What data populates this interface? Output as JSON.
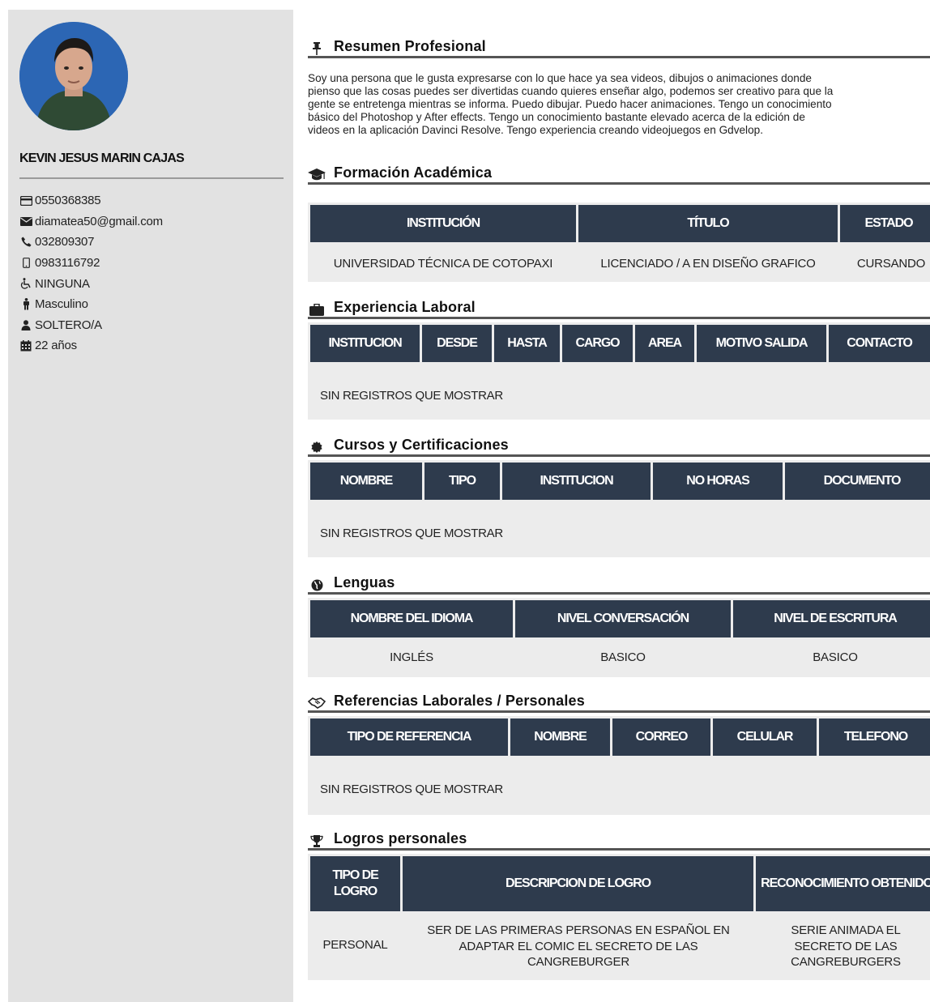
{
  "profile": {
    "name": "KEVIN JESUS MARIN CAJAS",
    "contacts": [
      {
        "icon": "id-card-icon",
        "text": "0550368385"
      },
      {
        "icon": "envelope-icon",
        "text": "diamatea50@gmail.com"
      },
      {
        "icon": "phone-icon",
        "text": "032809307"
      },
      {
        "icon": "mobile-icon",
        "text": "0983116792"
      },
      {
        "icon": "wheelchair-icon",
        "text": "NINGUNA"
      },
      {
        "icon": "male-icon",
        "text": "Masculino"
      },
      {
        "icon": "user-icon",
        "text": "SOLTERO/A"
      },
      {
        "icon": "calendar-icon",
        "text": "22 años"
      }
    ]
  },
  "summary": {
    "title": "Resumen Profesional",
    "lines": [
      "Soy una persona que le gusta expresarse con lo que hace ya sea videos, dibujos o animaciones donde",
      "pienso que las cosas puedes ser divertidas cuando quieres enseñar algo, podemos ser creativo para que la",
      "gente se entretenga mientras se informa. Puedo dibujar. Puedo hacer animaciones. Tengo un conocimiento",
      "básico del Photoshop y After effects. Tengo un conocimiento bastante elevado acerca de la edición de",
      "videos en la aplicación Davinci Resolve. Tengo experiencia creando videojuegos en Gdvelop."
    ]
  },
  "education": {
    "title": "Formación Académica",
    "headers": [
      "INSTITUCIÓN",
      "TÍTULO",
      "ESTADO"
    ],
    "row": [
      "UNIVERSIDAD TÉCNICA DE COTOPAXI",
      "LICENCIADO / A EN DISEÑO GRAFICO",
      "CURSANDO"
    ]
  },
  "experience": {
    "title": "Experiencia Laboral",
    "headers": [
      "INSTITUCION",
      "DESDE",
      "HASTA",
      "CARGO",
      "AREA",
      "MOTIVO SALIDA",
      "CONTACTO"
    ],
    "empty": "SIN REGISTROS QUE MOSTRAR"
  },
  "courses": {
    "title": "Cursos y Certificaciones",
    "headers": [
      "NOMBRE",
      "TIPO",
      "INSTITUCION",
      "NO HORAS",
      "DOCUMENTO"
    ],
    "empty": "SIN REGISTROS QUE MOSTRAR"
  },
  "languages": {
    "title": "Lenguas",
    "headers": [
      "NOMBRE DEL IDIOMA",
      "NIVEL CONVERSACIÓN",
      "NIVEL DE ESCRITURA"
    ],
    "row": [
      "INGLÉS",
      "BASICO",
      "BASICO"
    ]
  },
  "references": {
    "title": "Referencias Laborales / Personales",
    "headers": [
      "TIPO DE REFERENCIA",
      "NOMBRE",
      "CORREO",
      "CELULAR",
      "TELEFONO"
    ],
    "empty": "SIN REGISTROS QUE MOSTRAR"
  },
  "achievements": {
    "title": "Logros personales",
    "headers": [
      "TIPO DE LOGRO",
      "DESCRIPCION DE LOGRO",
      "RECONOCIMIENTO OBTENIDO"
    ],
    "row": [
      "PERSONAL",
      "SER DE LAS PRIMERAS PERSONAS EN ESPAÑOL EN ADAPTAR EL COMIC EL SECRETO DE LAS CANGREBURGER",
      "SERIE ANIMADA EL SECRETO DE LAS CANGREBURGERS"
    ]
  },
  "colors": {
    "sidebar": "#e2e2e2",
    "header_cell": "#2e3b4d",
    "table_bg": "#ececec"
  }
}
